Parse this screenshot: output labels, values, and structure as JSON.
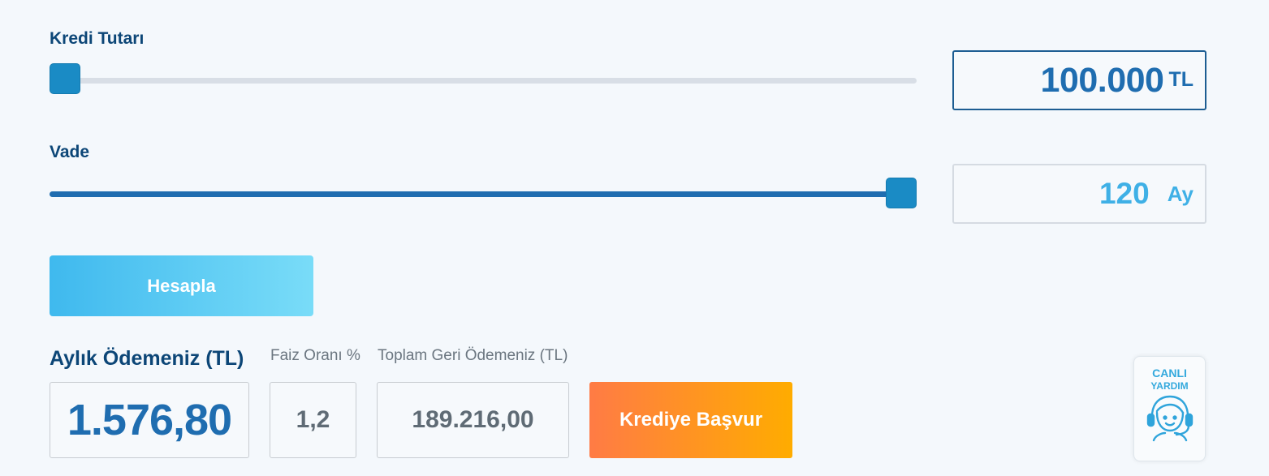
{
  "loan_amount": {
    "label": "Kredi Tutarı",
    "value": "100.000",
    "unit": "TL",
    "slider_position": 0.0
  },
  "term": {
    "label": "Vade",
    "value": "120",
    "unit": "Ay",
    "slider_position": 1.0
  },
  "calculate_button": "Hesapla",
  "results": {
    "monthly_payment_label": "Aylık Ödemeniz (TL)",
    "monthly_payment_value": "1.576,80",
    "interest_rate_label": "Faiz Oranı %",
    "interest_rate_value": "1,2",
    "total_repayment_label": "Toplam Geri Ödemeniz (TL)",
    "total_repayment_value": "189.216,00"
  },
  "apply_button": "Krediye Başvur",
  "live_help": {
    "line1": "CANLI",
    "line2": "YARDIM",
    "icon": "headset-agent-icon"
  },
  "colors": {
    "primary_blue": "#1f6db0",
    "light_blue": "#3fb0e6",
    "orange_start": "#ff7b45",
    "orange_end": "#ffac00"
  }
}
